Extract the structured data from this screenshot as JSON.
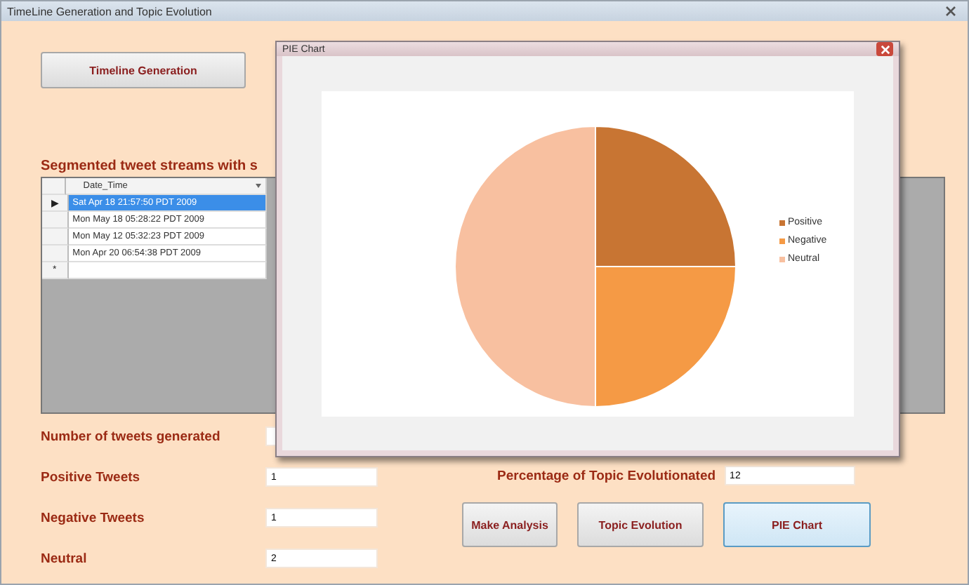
{
  "window": {
    "title": "TimeLine Generation and Topic Evolution"
  },
  "timeline_button": "Timeline Generation",
  "grid": {
    "title": "Segmented tweet streams with s",
    "columns": [
      "Date_Time"
    ],
    "rows": [
      {
        "marker": "▶",
        "cells": [
          "Sat Apr 18 21:57:50 PDT 2009"
        ],
        "selected": true
      },
      {
        "marker": "",
        "cells": [
          "Mon May 18 05:28:22 PDT 2009"
        ],
        "selected": false
      },
      {
        "marker": "",
        "cells": [
          "Mon May 12 05:32:23 PDT 2009"
        ],
        "selected": false
      },
      {
        "marker": "",
        "cells": [
          "Mon Apr 20 06:54:38 PDT 2009"
        ],
        "selected": false
      }
    ],
    "new_row_marker": "*"
  },
  "stats": [
    {
      "label": "Number of tweets generated"
    },
    {
      "label": "Positive Tweets",
      "value": "1"
    },
    {
      "label": "Negative Tweets",
      "value": "1"
    },
    {
      "label": "Neutral",
      "value": "2"
    }
  ],
  "percentage": {
    "label": "Percentage of Topic Evolutionated",
    "value": "12"
  },
  "buttons": [
    {
      "label": "Make Analysis",
      "selected": false
    },
    {
      "label": "Topic Evolution",
      "selected": false
    },
    {
      "label": "PIE Chart",
      "selected": true
    }
  ],
  "dialog": {
    "title": "PIE Chart",
    "chart_data": {
      "type": "pie",
      "categories": [
        "Positive",
        "Negative",
        "Neutral"
      ],
      "values": [
        25,
        25,
        50
      ],
      "legend": true,
      "colors": [
        "#c87533",
        "#f59a45",
        "#f8c0a0"
      ]
    }
  }
}
